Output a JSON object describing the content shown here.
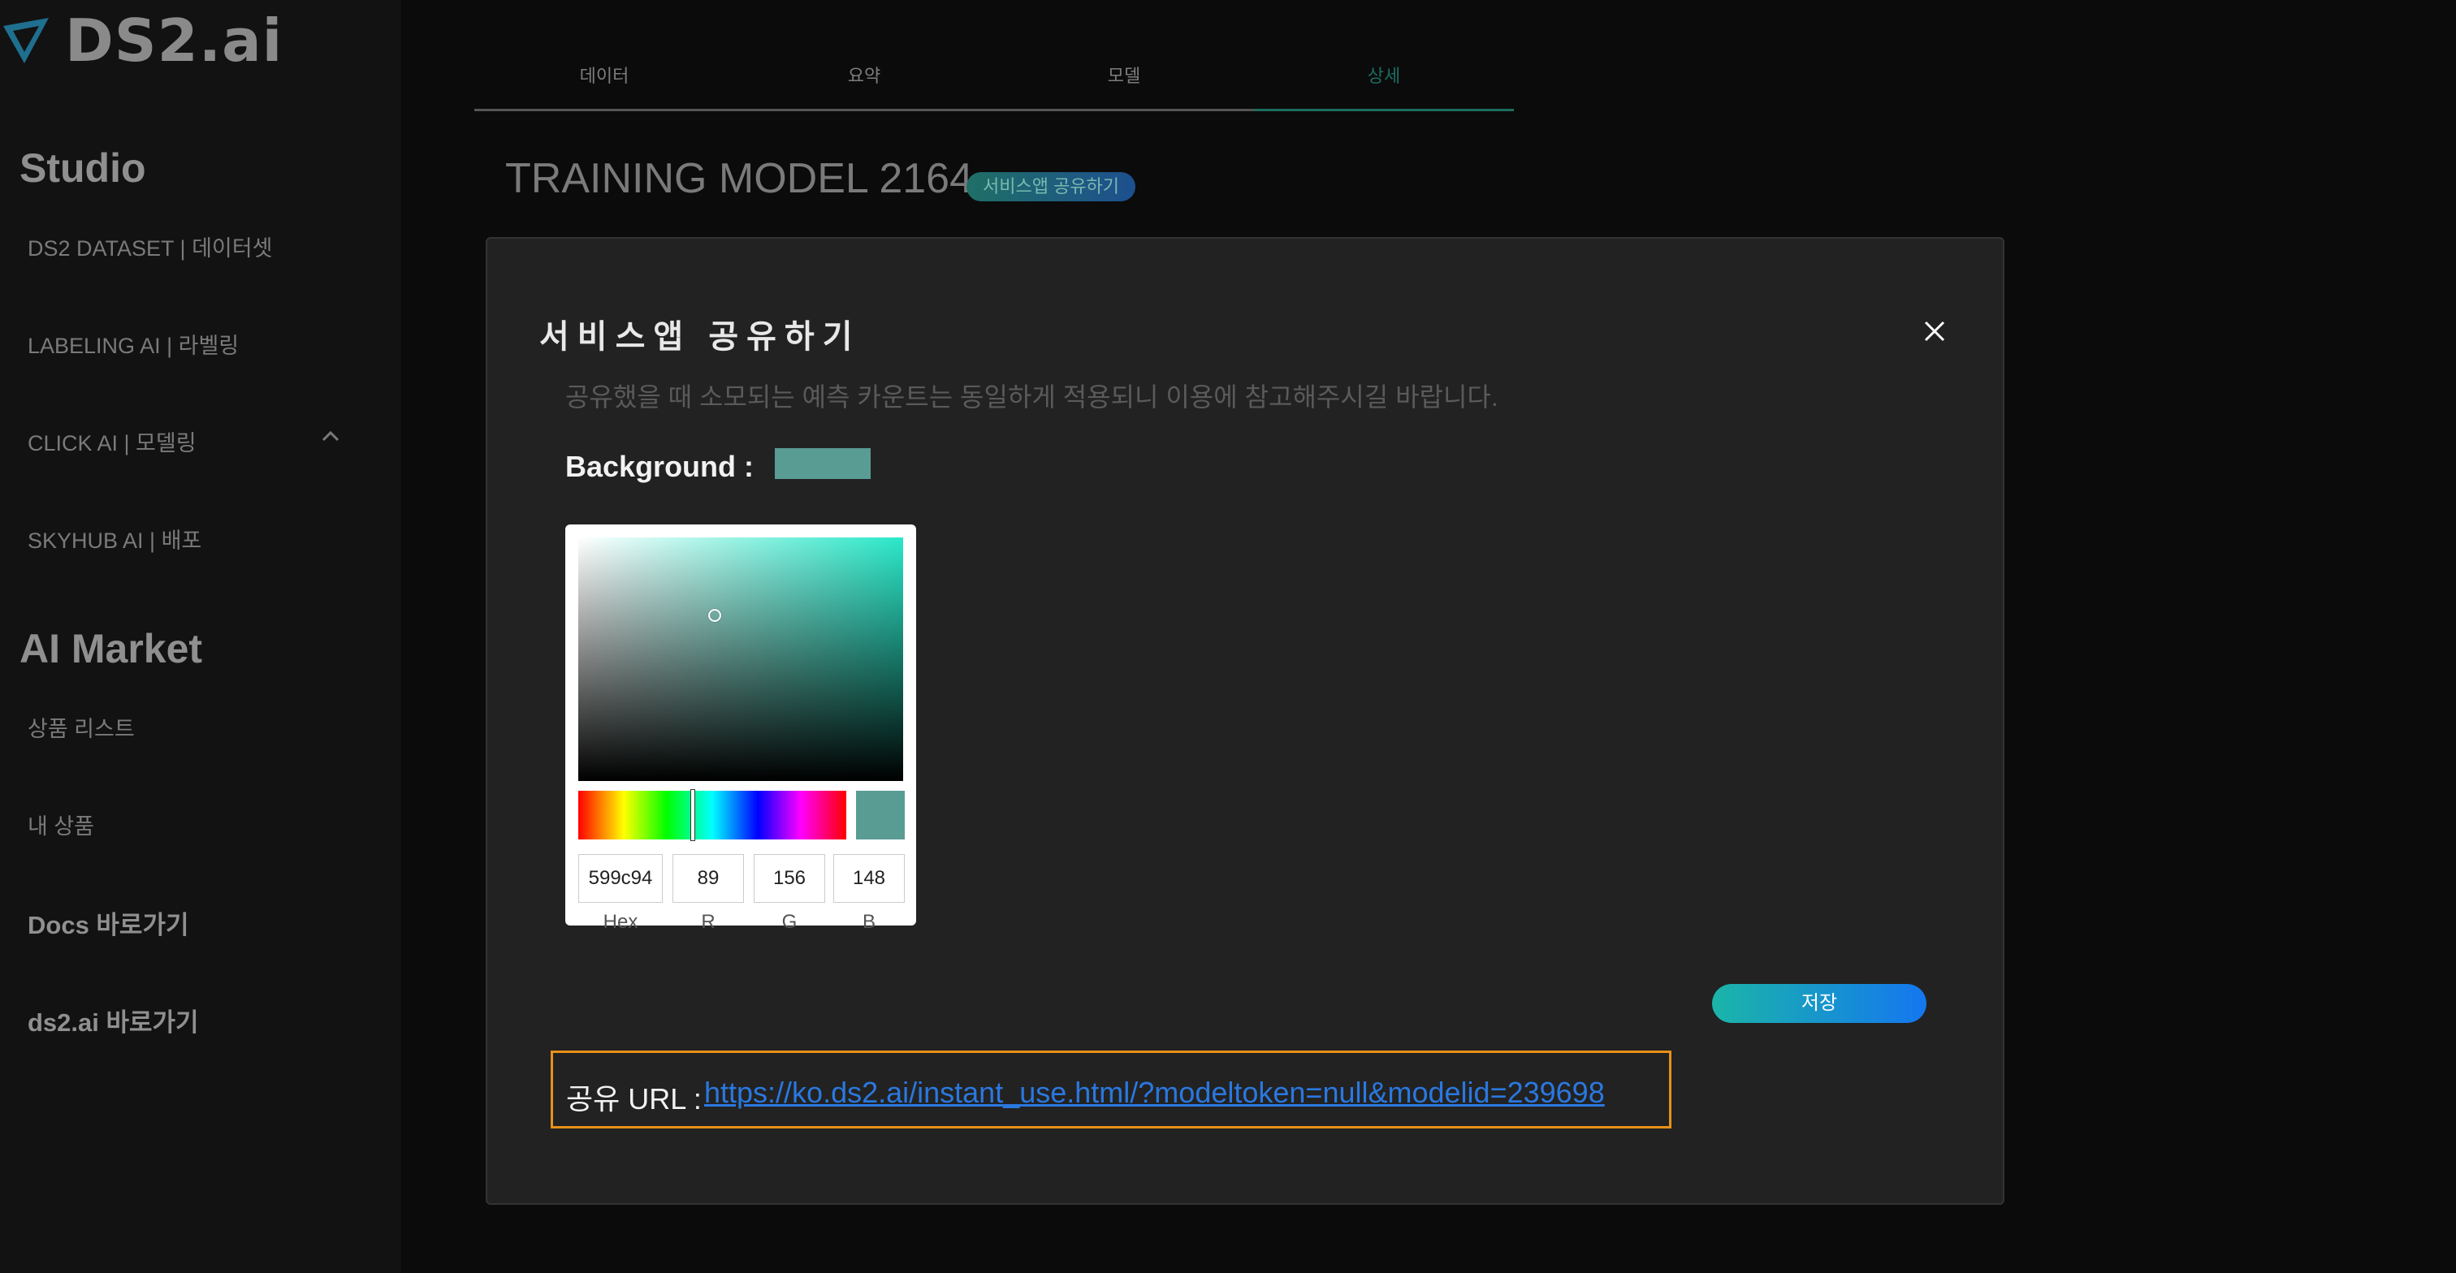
{
  "brand": {
    "logo_text": "DS2.ai",
    "accent": "#1bb5a8"
  },
  "sidebar": {
    "studio_title": "Studio",
    "studio_items": [
      {
        "label": "DS2 DATASET | 데이터셋"
      },
      {
        "label": "LABELING AI | 라벨링"
      },
      {
        "label": "CLICK AI | 모델링"
      },
      {
        "label": "SKYHUB AI | 배포"
      }
    ],
    "market_title": "AI Market",
    "market_items": [
      {
        "label": "상품 리스트"
      },
      {
        "label": "내 상품"
      }
    ],
    "links": [
      {
        "label": "Docs 바로가기"
      },
      {
        "label": "ds2.ai 바로가기"
      }
    ]
  },
  "tabs": [
    {
      "label": "데이터"
    },
    {
      "label": "요약"
    },
    {
      "label": "모델"
    },
    {
      "label": "상세",
      "active": true
    }
  ],
  "page": {
    "model_title": "TRAINING MODEL 2164",
    "share_pill": "서비스앱 공유하기"
  },
  "modal": {
    "title": "서비스앱 공유하기",
    "description": "공유했을 때 소모되는 예측 카운트는 동일하게 적용되니 이용에 참고해주시길 바랍니다.",
    "background_label": "Background :",
    "background_color": "#599c94",
    "picker": {
      "hex": "599c94",
      "r": "89",
      "g": "156",
      "b": "148",
      "labels": {
        "hex": "Hex",
        "r": "R",
        "g": "G",
        "b": "B"
      }
    },
    "save_label": "저장",
    "url_label": "공유 URL :",
    "url": "https://ko.ds2.ai/instant_use.html/?modeltoken=null&modelid=239698"
  }
}
